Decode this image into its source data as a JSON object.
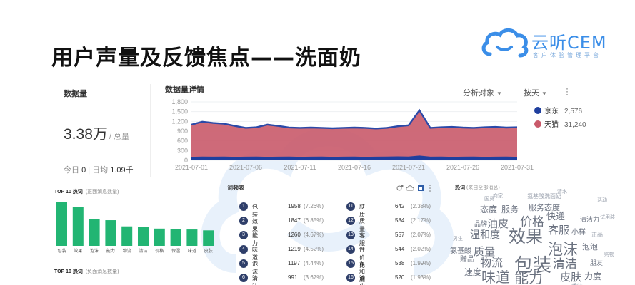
{
  "header": {
    "title": "用户声量及反馈焦点——洗面奶",
    "logo_text": "云听CEM",
    "logo_sub": "客户体验管理平台"
  },
  "volume": {
    "title": "数据量",
    "value": "3.38万",
    "unit": "/ 总量",
    "today_label": "今日",
    "today_value": "0",
    "daily_label": "日均",
    "daily_value": "1.09千"
  },
  "detail": {
    "title": "数据量详情",
    "analysis_label": "分析对象",
    "period_label": "按天",
    "legend": [
      {
        "name": "京东",
        "value": "2,576",
        "color": "#1f3f9e"
      },
      {
        "name": "天猫",
        "value": "31,240",
        "color": "#c95a6a"
      }
    ]
  },
  "chart_data": {
    "type": "area",
    "x_ticks": [
      "2021-07-01",
      "2021-07-06",
      "2021-07-11",
      "2021-07-16",
      "2021-07-21",
      "2021-07-26",
      "2021-07-31"
    ],
    "y_ticks": [
      "1,800",
      "1,500",
      "1,200",
      "900",
      "600",
      "300",
      "0"
    ],
    "ylim": [
      0,
      1800
    ],
    "xlabel": "",
    "ylabel": "",
    "series": [
      {
        "name": "天猫",
        "color": "#c95a6a",
        "values": [
          1100,
          1190,
          1150,
          1130,
          1060,
          1000,
          1020,
          1100,
          1060,
          1010,
          1000,
          1010,
          1000,
          990,
          1000,
          1010,
          1000,
          980,
          1000,
          1050,
          1080,
          1540,
          1000,
          1020,
          1030,
          1010,
          1000,
          1020,
          1030,
          1010,
          1020
        ]
      },
      {
        "name": "京东",
        "color": "#1f3f9e",
        "values": [
          80,
          90,
          85,
          90,
          80,
          85,
          90,
          80,
          85,
          90,
          80,
          85,
          90,
          80,
          85,
          90,
          80,
          85,
          90,
          95,
          90,
          120,
          85,
          90,
          80,
          85,
          90,
          80,
          85,
          90,
          80
        ]
      }
    ]
  },
  "top10_positive": {
    "title": "TOP 10 热词",
    "subtitle": "(正面消息数量)",
    "bar_color": "#22b573",
    "categories": [
      "包装",
      "效果",
      "泡沫",
      "能力",
      "物流",
      "清洁",
      "价格",
      "保湿",
      "味道",
      "皮肤"
    ],
    "values": [
      100,
      88,
      60,
      58,
      44,
      43,
      39,
      38,
      37,
      35
    ]
  },
  "top10_negative": {
    "title": "TOP 10 热词",
    "subtitle": "(负面消息数量)"
  },
  "words": {
    "title": "词频表",
    "items": [
      {
        "rank": "1",
        "word": "包装",
        "count": "1958",
        "pct": "(7.26%)"
      },
      {
        "rank": "2",
        "word": "效果",
        "count": "1847",
        "pct": "(6.85%)"
      },
      {
        "rank": "3",
        "word": "能力",
        "count": "1260",
        "pct": "(4.67%)"
      },
      {
        "rank": "4",
        "word": "味道",
        "count": "1219",
        "pct": "(4.52%)"
      },
      {
        "rank": "5",
        "word": "泡沫",
        "count": "1197",
        "pct": "(4.44%)"
      },
      {
        "rank": "6",
        "word": "清洁",
        "count": "991",
        "pct": "(3.67%)"
      },
      {
        "rank": "11",
        "word": "肤质",
        "count": "642",
        "pct": "(2.38%)"
      },
      {
        "rank": "12",
        "word": "质量",
        "count": "584",
        "pct": "(2.17%)"
      },
      {
        "rank": "13",
        "word": "客服",
        "count": "557",
        "pct": "(2.07%)"
      },
      {
        "rank": "14",
        "word": "性价比",
        "count": "544",
        "pct": "(2.02%)"
      },
      {
        "rank": "15",
        "word": "温和度",
        "count": "538",
        "pct": "(1.99%)"
      },
      {
        "rank": "16",
        "word": "油皮",
        "count": "520",
        "pct": "(1.93%)"
      }
    ]
  },
  "hot": {
    "title": "热词",
    "subtitle": "(来自全部消息)",
    "cloud": [
      {
        "t": "效果",
        "s": 24,
        "c": "#6b7280"
      },
      {
        "t": "泡沫",
        "s": 21,
        "c": "#6b7280"
      },
      {
        "t": "包装",
        "s": 26,
        "c": "#6b7280"
      },
      {
        "t": "价格",
        "s": 17,
        "c": "#6b7280"
      },
      {
        "t": "油皮",
        "s": 15,
        "c": "#6b7280"
      },
      {
        "t": "客服",
        "s": 15,
        "c": "#6b7280"
      },
      {
        "t": "温和度",
        "s": 14,
        "c": "#6b7280"
      },
      {
        "t": "质量",
        "s": 15,
        "c": "#6b7280"
      },
      {
        "t": "物流",
        "s": 16,
        "c": "#6b7280"
      },
      {
        "t": "清洁",
        "s": 17,
        "c": "#6b7280"
      },
      {
        "t": "味道",
        "s": 20,
        "c": "#6b7280"
      },
      {
        "t": "能力",
        "s": 20,
        "c": "#6b7280"
      },
      {
        "t": "皮肤",
        "s": 15,
        "c": "#6b7280"
      },
      {
        "t": "服务态度",
        "s": 11,
        "c": "#6b7280"
      },
      {
        "t": "快递",
        "s": 13,
        "c": "#6b7280"
      },
      {
        "t": "态度",
        "s": 12,
        "c": "#6b7280"
      },
      {
        "t": "服务",
        "s": 12,
        "c": "#6b7280"
      },
      {
        "t": "氨基酸",
        "s": 10,
        "c": "#6b7280"
      },
      {
        "t": "泡泡",
        "s": 11,
        "c": "#6b7280"
      },
      {
        "t": "赠品",
        "s": 10,
        "c": "#6b7280"
      },
      {
        "t": "速度",
        "s": 12,
        "c": "#6b7280"
      },
      {
        "t": "力度",
        "s": 12,
        "c": "#6b7280"
      },
      {
        "t": "朋友",
        "s": 9,
        "c": "#6b7280"
      },
      {
        "t": "小样",
        "s": 10,
        "c": "#6b7280"
      },
      {
        "t": "品牌",
        "s": 9,
        "c": "#6b7280"
      },
      {
        "t": "清洁力",
        "s": 9,
        "c": "#6b7280"
      },
      {
        "t": "氨基酸洗面奶",
        "s": 8,
        "c": "#9ca3af"
      },
      {
        "t": "正品",
        "s": 8,
        "c": "#9ca3af"
      },
      {
        "t": "试用装",
        "s": 7,
        "c": "#9ca3af"
      },
      {
        "t": "购物",
        "s": 7,
        "c": "#9ca3af"
      },
      {
        "t": "商家",
        "s": 7,
        "c": "#9ca3af"
      },
      {
        "t": "国货",
        "s": 7,
        "c": "#9ca3af"
      },
      {
        "t": "清水",
        "s": 7,
        "c": "#9ca3af"
      },
      {
        "t": "男生",
        "s": 7,
        "c": "#9ca3af"
      },
      {
        "t": "香味",
        "s": 8,
        "c": "#9ca3af"
      },
      {
        "t": "活动",
        "s": 7,
        "c": "#9ca3af"
      }
    ]
  }
}
